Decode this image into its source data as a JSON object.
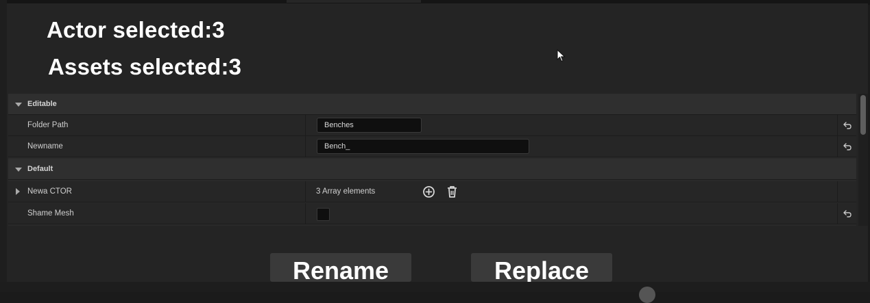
{
  "header": {
    "actor_selected": "Actor selected:3",
    "assets_selected": "Assets selected:3"
  },
  "details": {
    "categories": {
      "editable": "Editable",
      "default": "Default"
    },
    "properties": {
      "folder_path": {
        "label": "Folder Path",
        "value": "Benches"
      },
      "newname": {
        "label": "Newname",
        "value": "Bench_"
      },
      "newa_ctor": {
        "label": "Newa CTOR",
        "value": "3 Array elements"
      },
      "shame_mesh": {
        "label": "Shame Mesh",
        "checked": false
      }
    }
  },
  "buttons": {
    "rename": "Rename",
    "replace": "Replace"
  },
  "icons": {
    "add": "add-element-icon",
    "delete": "trash-icon",
    "reset": "reset-to-default-icon",
    "expand": "expand-arrow-icon"
  }
}
